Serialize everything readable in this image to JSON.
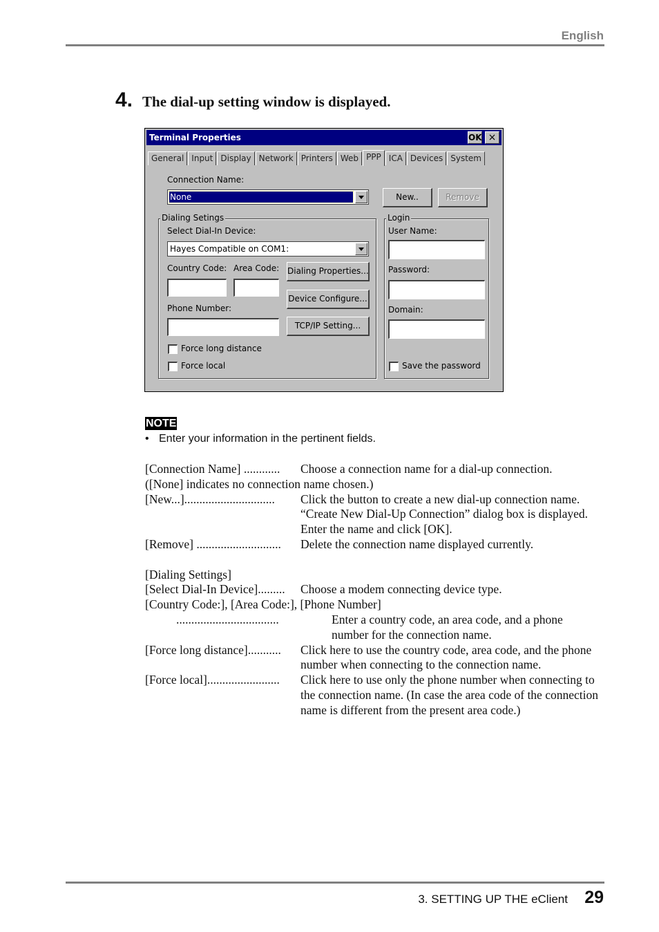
{
  "header": {
    "language": "English"
  },
  "step": {
    "number": "4.",
    "text": "The dial-up setting window is displayed."
  },
  "dialog": {
    "title": "Terminal Properties",
    "ok_label": "OK",
    "close_label": "×",
    "tabs": [
      "General",
      "Input",
      "Display",
      "Network",
      "Printers",
      "Web",
      "PPP",
      "ICA",
      "Devices",
      "System"
    ],
    "active_tab": "PPP",
    "connection_name_label": "Connection Name:",
    "connection_name_value": "None",
    "new_button": "New..",
    "remove_button": "Remove",
    "dialing_group": {
      "legend": "Dialing Setings",
      "select_device_label": "Select Dial-In Device:",
      "device_value": "Hayes Compatible on COM1:",
      "country_code_label": "Country Code:",
      "area_code_label": "Area Code:",
      "phone_number_label": "Phone Number:",
      "country_code_value": "",
      "area_code_value": "",
      "phone_number_value": "",
      "dialing_properties_button": "Dialing Properties...",
      "device_configure_button": "Device Configure...",
      "tcpip_button": "TCP/IP Setting...",
      "force_long_distance_label": "Force long distance",
      "force_long_distance_checked": false,
      "force_local_label": "Force local",
      "force_local_checked": false
    },
    "login_group": {
      "legend": "Login",
      "user_name_label": "User Name:",
      "password_label": "Password:",
      "domain_label": "Domain:",
      "user_name_value": "",
      "password_value": "",
      "domain_value": "",
      "save_password_label": "Save the password",
      "save_password_checked": false
    }
  },
  "note": {
    "tag": "NOTE",
    "bullet": "•",
    "text": "Enter your information in the pertinent fields."
  },
  "definitions": {
    "connection_name_term": "[Connection Name] ............",
    "connection_name_desc": "Choose a connection name for a dial-up connection.",
    "connection_name_extra": "([None] indicates no connection name chosen.)",
    "new_term": "[New...]..............................",
    "new_desc_1": "Click the button to create a new dial-up connection name.",
    "new_desc_2": "“Create New Dial-Up Connection” dialog box is displayed.",
    "new_desc_3": "Enter the name and click [OK].",
    "remove_term": "[Remove] ............................",
    "remove_desc": "Delete the connection name displayed currently.",
    "dialing_heading": "[Dialing Settings]",
    "select_device_term": "[Select Dial-In Device].........",
    "select_device_desc": "Choose a modem connecting device type.",
    "codes_heading": "[Country Code:], [Area Code:], [Phone Number]",
    "codes_term": "..................................",
    "codes_desc": "Enter a country code, an area code, and a phone number for the connection name.",
    "long_distance_term": "[Force long distance]...........",
    "long_distance_desc": "Click here to use the country code, area code, and the phone number when connecting to the connection name.",
    "local_term": "[Force local]........................",
    "local_desc": "Click here to use only the phone number when connecting to the connection name.  (In case the area code of the connection name is different from the present area code.)"
  },
  "footer": {
    "section": "3. SETTING UP THE eClient",
    "page": "29"
  }
}
